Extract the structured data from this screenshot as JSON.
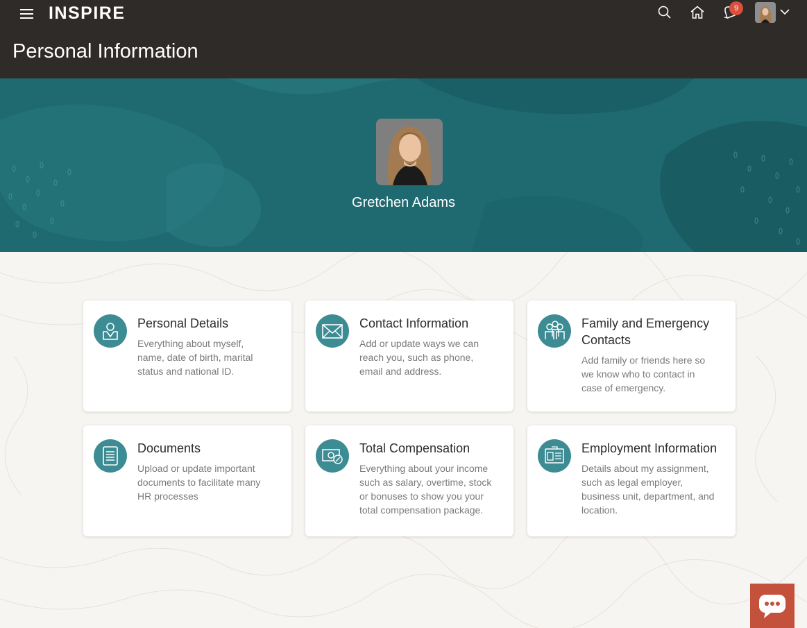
{
  "app": {
    "brand": "INSPIRE"
  },
  "header": {
    "page_title": "Personal Information",
    "notification_count": "9"
  },
  "profile": {
    "name": "Gretchen Adams"
  },
  "cards": [
    {
      "title": "Personal Details",
      "description": "Everything about myself, name, date of birth, marital status and national ID.",
      "icon": "person-id-icon"
    },
    {
      "title": "Contact Information",
      "description": "Add or update ways we can reach you, such as phone, email and address.",
      "icon": "envelope-icon"
    },
    {
      "title": "Family and Emergency Contacts",
      "description": "Add family or friends here so we know who to contact in case of emergency.",
      "icon": "family-icon"
    },
    {
      "title": "Documents",
      "description": "Upload or update important documents to facilitate many HR processes",
      "icon": "document-icon"
    },
    {
      "title": "Total Compensation",
      "description": "Everything about your income such as salary, overtime, stock or bonuses to show you your total compensation package.",
      "icon": "money-icon"
    },
    {
      "title": "Employment Information",
      "description": "Details about my assignment, such as legal employer, business unit, department, and location.",
      "icon": "id-card-icon"
    }
  ],
  "colors": {
    "header_bg": "#2f2b28",
    "hero_bg": "#1f6a70",
    "icon_bg": "#3d8c94",
    "badge": "#d9513d",
    "chat_button": "#c4513b"
  }
}
